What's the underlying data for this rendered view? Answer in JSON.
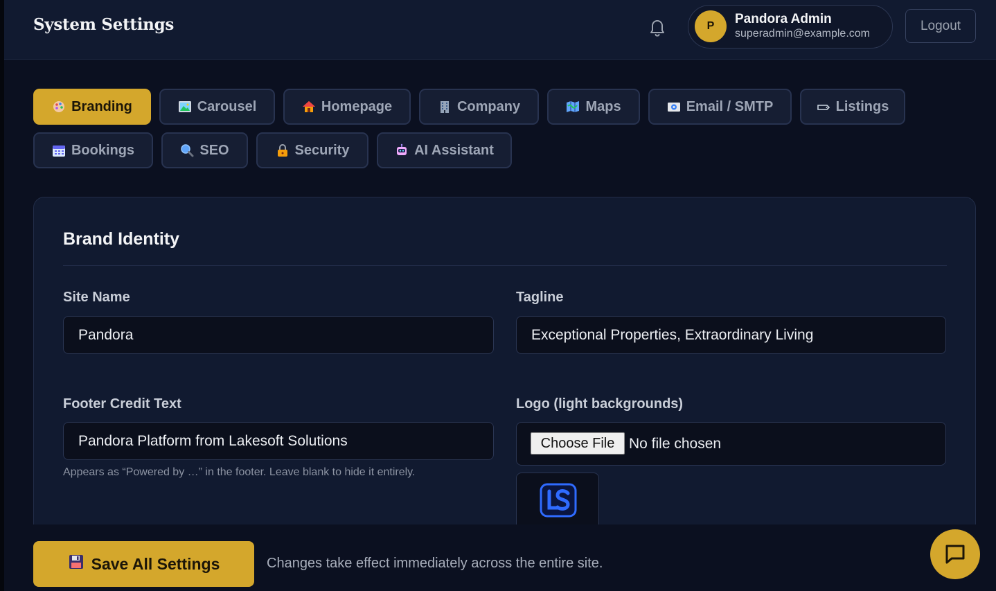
{
  "header": {
    "title": "System Settings",
    "user": {
      "initial": "P",
      "name": "Pandora Admin",
      "email": "superadmin@example.com"
    },
    "logout_label": "Logout"
  },
  "tabs": [
    {
      "label": "Branding",
      "icon": "palette-icon",
      "active": true
    },
    {
      "label": "Carousel",
      "icon": "picture-icon",
      "active": false
    },
    {
      "label": "Homepage",
      "icon": "house-icon",
      "active": false
    },
    {
      "label": "Company",
      "icon": "building-icon",
      "active": false
    },
    {
      "label": "Maps",
      "icon": "map-icon",
      "active": false
    },
    {
      "label": "Email / SMTP",
      "icon": "email-icon",
      "active": false
    },
    {
      "label": "Listings",
      "icon": "tag-icon",
      "active": false
    },
    {
      "label": "Bookings",
      "icon": "calendar-icon",
      "active": false
    },
    {
      "label": "SEO",
      "icon": "magnifier-icon",
      "active": false
    },
    {
      "label": "Security",
      "icon": "lock-icon",
      "active": false
    },
    {
      "label": "AI Assistant",
      "icon": "robot-icon",
      "active": false
    }
  ],
  "brand_identity": {
    "title": "Brand Identity",
    "site_name": {
      "label": "Site Name",
      "value": "Pandora"
    },
    "tagline": {
      "label": "Tagline",
      "value": "Exceptional Properties, Extraordinary Living"
    },
    "footer_credit": {
      "label": "Footer Credit Text",
      "value": "Pandora Platform from Lakesoft Solutions",
      "help": "Appears as “Powered by …” in the footer. Leave blank to hide it entirely."
    },
    "logo_light": {
      "label": "Logo (light backgrounds)",
      "button_label": "Choose File",
      "status": "No file chosen",
      "preview_icon": "ls-logo-icon"
    }
  },
  "footer": {
    "save_label": "Save All Settings",
    "save_icon": "floppy-disk-icon",
    "note": "Changes take effect immediately across the entire site.",
    "chat_icon": "chat-bubble-icon"
  },
  "colors": {
    "accent": "#d4a72c",
    "background": "#0b1020",
    "surface": "#111a30",
    "input_bg": "#0b0f1c"
  }
}
